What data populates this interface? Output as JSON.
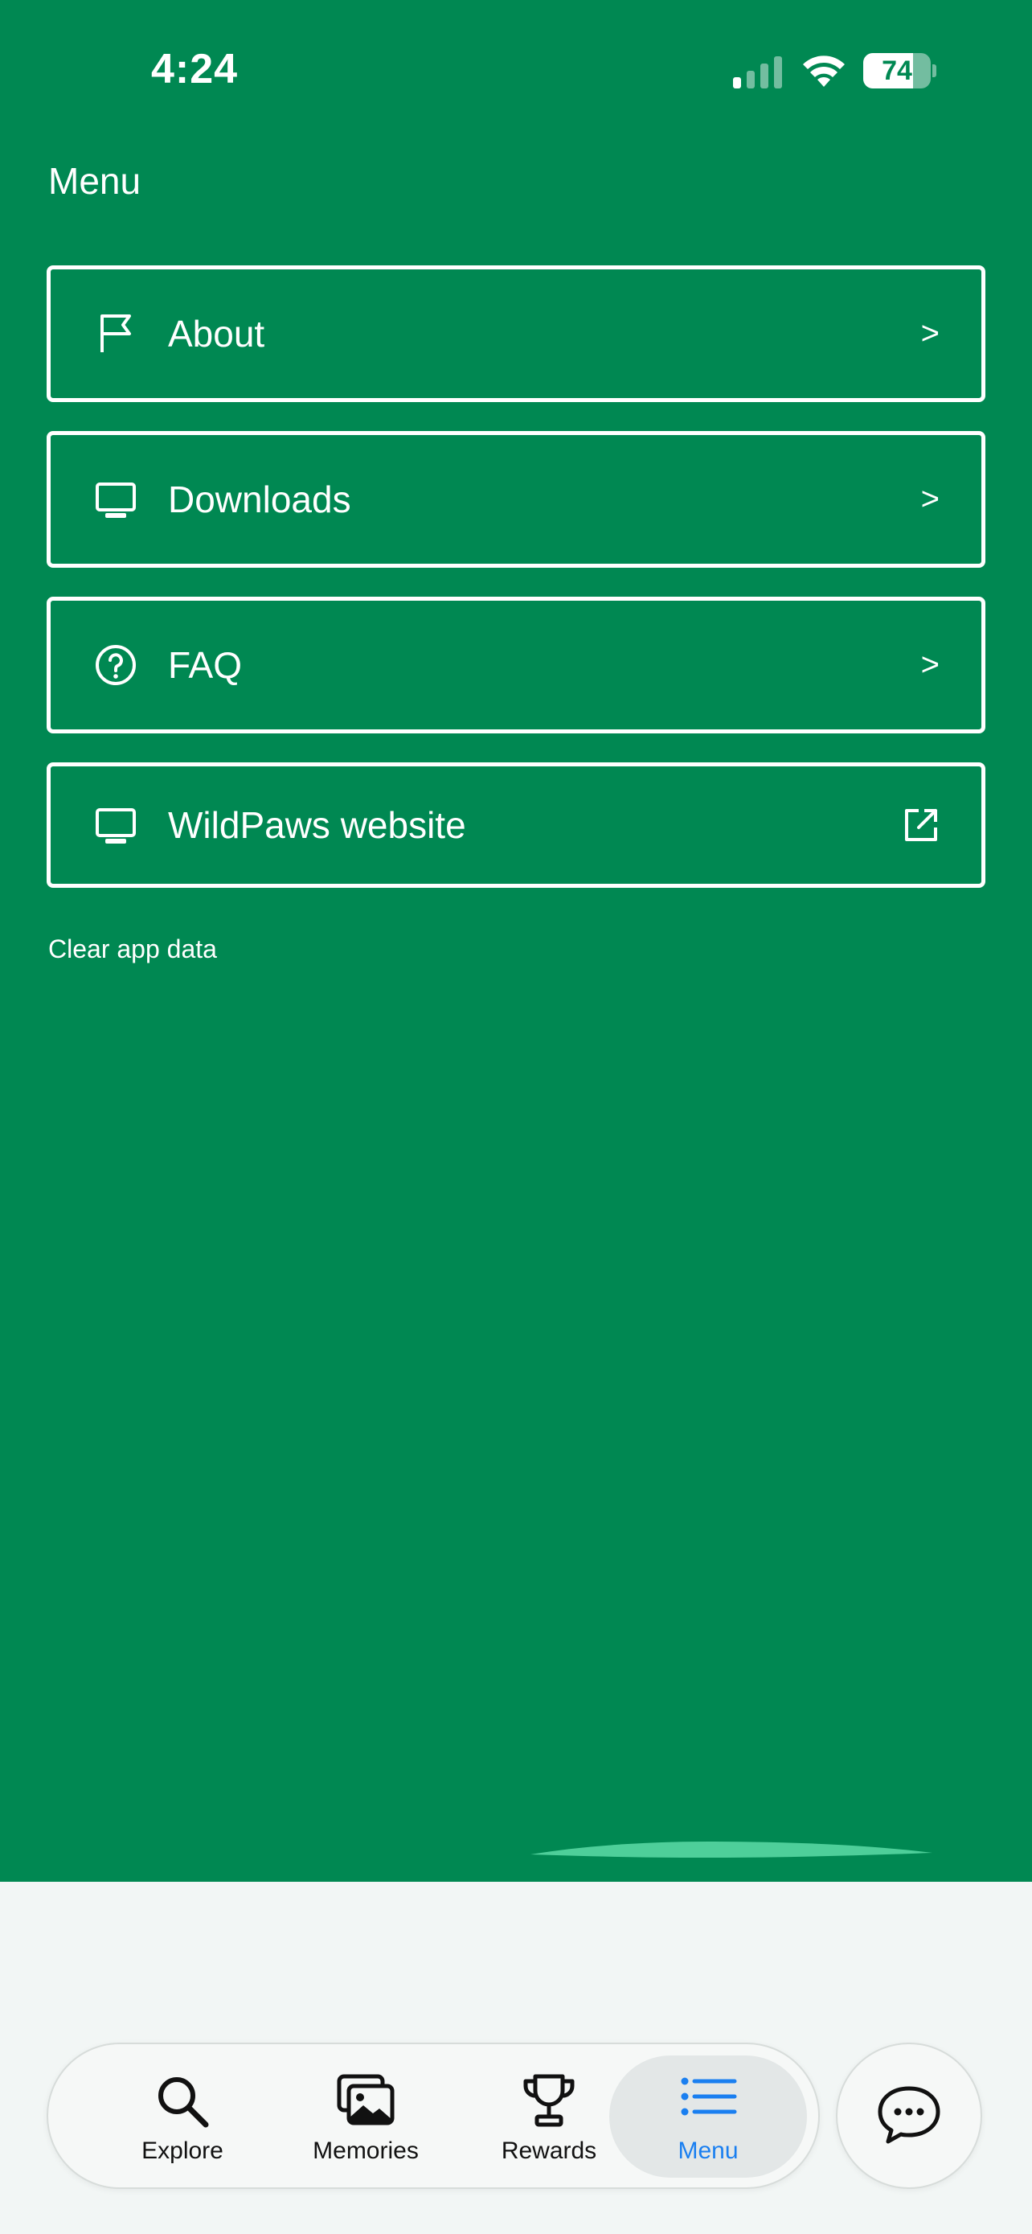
{
  "status_bar": {
    "time": "4:24",
    "battery_percent": "74",
    "battery_level": 74,
    "signal_icon": "cellular-signal-icon",
    "wifi_icon": "wifi-icon"
  },
  "page": {
    "title": "Menu"
  },
  "menu": {
    "items": [
      {
        "label": "About",
        "icon": "flag-icon",
        "trailing": ">"
      },
      {
        "label": "Downloads",
        "icon": "monitor-icon",
        "trailing": ">"
      },
      {
        "label": "FAQ",
        "icon": "question-circle-icon",
        "trailing": ">"
      },
      {
        "label": "WildPaws website",
        "icon": "monitor-icon",
        "trailing_icon": "external-link-icon"
      }
    ],
    "clear_data_label": "Clear app data"
  },
  "tab_bar": {
    "tabs": [
      {
        "label": "Explore",
        "icon": "search-icon"
      },
      {
        "label": "Memories",
        "icon": "images-icon"
      },
      {
        "label": "Rewards",
        "icon": "trophy-icon"
      },
      {
        "label": "Menu",
        "icon": "list-icon",
        "active": true
      }
    ],
    "chat_icon": "chat-bubble-icon"
  },
  "colors": {
    "brand_green": "#008852",
    "wave_accent": "#4ecf9a",
    "active_tab": "#1a7ff0",
    "background": "#f2f6f5"
  }
}
